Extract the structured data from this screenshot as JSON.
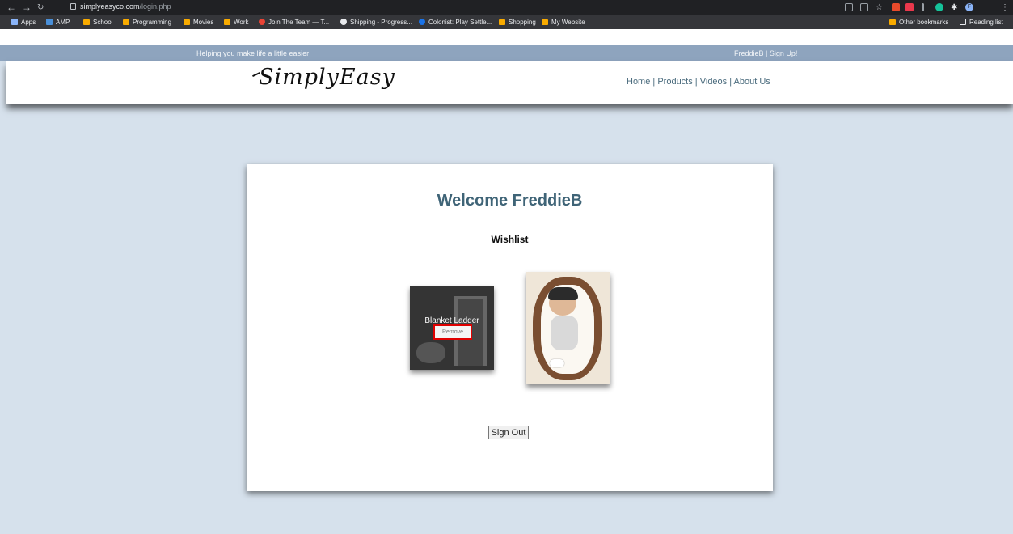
{
  "browser": {
    "url_host": "simplyeasyco.com",
    "url_path": "/login.php",
    "bookmarks": [
      "Apps",
      "AMP",
      "School",
      "Programming",
      "Movies",
      "Work",
      "Join The Team — T...",
      "Shipping - Progress...",
      "Colonist: Play Settle...",
      "Shopping",
      "My Website"
    ],
    "other_bookmarks": "Other bookmarks",
    "reading_list": "Reading list",
    "profile_initial": "F",
    "accent": "#f9ab00"
  },
  "site": {
    "tagline": "Helping you make life a little easier",
    "user_links": "FreddieB | Sign Up!",
    "logo_text": "SimplyEasy",
    "nav": [
      "Home",
      "Products",
      "Videos",
      "About Us"
    ],
    "nav_separator": " | "
  },
  "main": {
    "welcome": "Welcome FreddieB",
    "wishlist_heading": "Wishlist",
    "items": [
      {
        "title": "Blanket Ladder",
        "remove_label": "Remove"
      },
      {
        "title": ""
      }
    ],
    "sign_out": "Sign Out"
  },
  "colors": {
    "page_background": "#d6e1ec",
    "topbar": "#8ea4be",
    "heading": "#3f6477",
    "highlight": "#e00000"
  }
}
